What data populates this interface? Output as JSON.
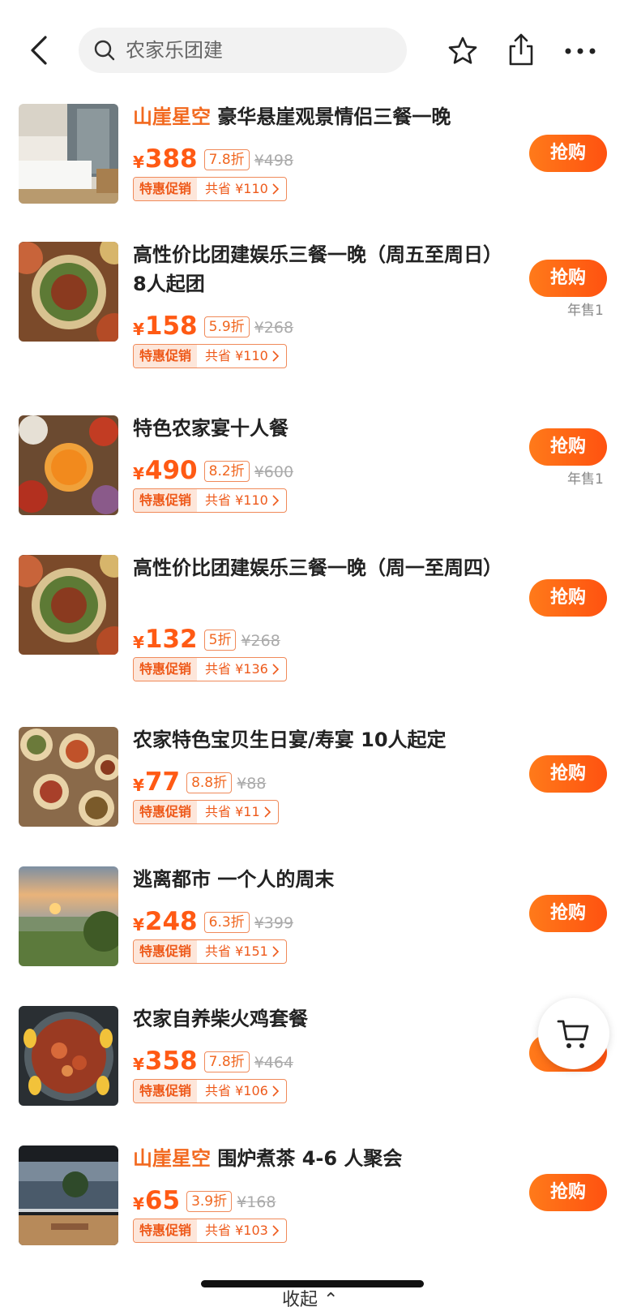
{
  "header": {
    "search_placeholder": "农家乐团建"
  },
  "colors": {
    "accent": "#ff5a14",
    "brand": "#f2691f"
  },
  "products": [
    {
      "brand": "山崖星空",
      "title": "豪华悬崖观景情侣三餐一晚",
      "yen": "¥",
      "price": "388",
      "discount": "7.8折",
      "original": "¥498",
      "promo_tag": "特惠促销",
      "saving": "共省 ¥110",
      "button": "抢购",
      "sold": ""
    },
    {
      "brand": "",
      "title": "高性价比团建娱乐三餐一晚（周五至周日）8人起团",
      "yen": "¥",
      "price": "158",
      "discount": "5.9折",
      "original": "¥268",
      "promo_tag": "特惠促销",
      "saving": "共省 ¥110",
      "button": "抢购",
      "sold": "年售1"
    },
    {
      "brand": "",
      "title": "特色农家宴十人餐",
      "yen": "¥",
      "price": "490",
      "discount": "8.2折",
      "original": "¥600",
      "promo_tag": "特惠促销",
      "saving": "共省 ¥110",
      "button": "抢购",
      "sold": "年售1"
    },
    {
      "brand": "",
      "title": "高性价比团建娱乐三餐一晚（周一至周四）",
      "yen": "¥",
      "price": "132",
      "discount": "5折",
      "original": "¥268",
      "promo_tag": "特惠促销",
      "saving": "共省 ¥136",
      "button": "抢购",
      "sold": ""
    },
    {
      "brand": "",
      "title": "农家特色宝贝生日宴/寿宴  10人起定",
      "yen": "¥",
      "price": "77",
      "discount": "8.8折",
      "original": "¥88",
      "promo_tag": "特惠促销",
      "saving": "共省 ¥11",
      "button": "抢购",
      "sold": ""
    },
    {
      "brand": "",
      "title": "逃离都市 一个人的周末",
      "yen": "¥",
      "price": "248",
      "discount": "6.3折",
      "original": "¥399",
      "promo_tag": "特惠促销",
      "saving": "共省 ¥151",
      "button": "抢购",
      "sold": ""
    },
    {
      "brand": "",
      "title": "农家自养柴火鸡套餐",
      "yen": "¥",
      "price": "358",
      "discount": "7.8折",
      "original": "¥464",
      "promo_tag": "特惠促销",
      "saving": "共省 ¥106",
      "button": "抢购",
      "sold": ""
    },
    {
      "brand": "山崖星空",
      "title": "围炉煮茶 4-6 人聚会",
      "yen": "¥",
      "price": "65",
      "discount": "3.9折",
      "original": "¥168",
      "promo_tag": "特惠促销",
      "saving": "共省 ¥103",
      "button": "抢购",
      "sold": ""
    }
  ],
  "footer": {
    "collapse_label": "收起 ⌃"
  }
}
